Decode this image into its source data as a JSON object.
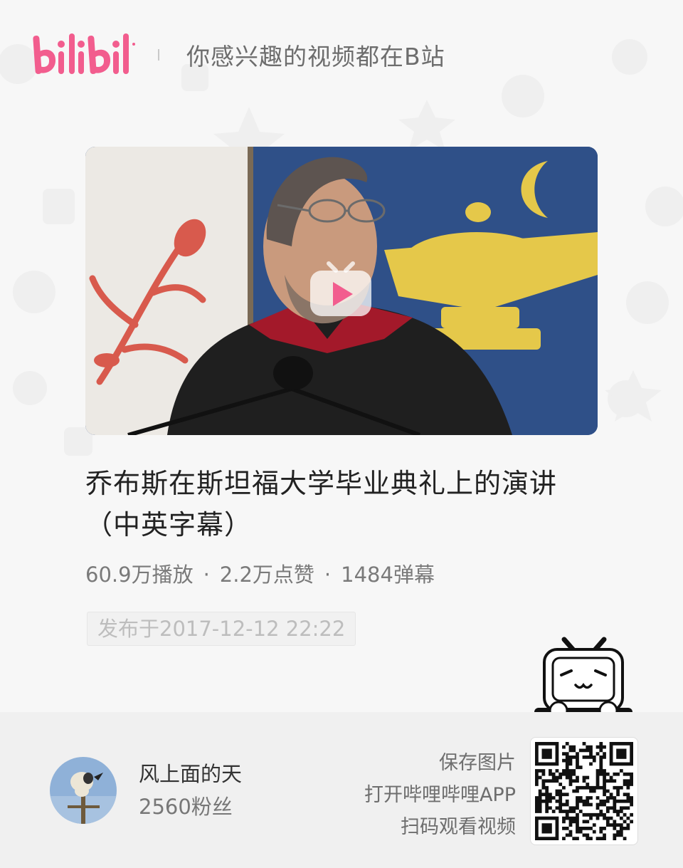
{
  "header": {
    "brand": "bilibili",
    "slogan": "你感兴趣的视频都在B站"
  },
  "video": {
    "title": "乔布斯在斯坦福大学毕业典礼上的演讲（中英字幕）",
    "stats": {
      "plays": "60.9万播放",
      "likes": "2.2万点赞",
      "danmaku": "1484弹幕",
      "separator": "·"
    },
    "published": "发布于2017-12-12 22:22"
  },
  "uploader": {
    "name": "风上面的天",
    "fans": "2560粉丝"
  },
  "cta": {
    "line1": "保存图片",
    "line2": "打开哔哩哔哩APP",
    "line3": "扫码观看视频"
  },
  "colors": {
    "brand_pink": "#f25d8e",
    "background": "#f7f7f7",
    "footer_bg": "#f0f0f0",
    "title_text": "#222222",
    "secondary_text": "#7a7a7a"
  },
  "icons": {
    "play": "tv-play-icon",
    "mascot": "bilibili-tv-mascot-icon",
    "qr": "qr-code-icon"
  }
}
